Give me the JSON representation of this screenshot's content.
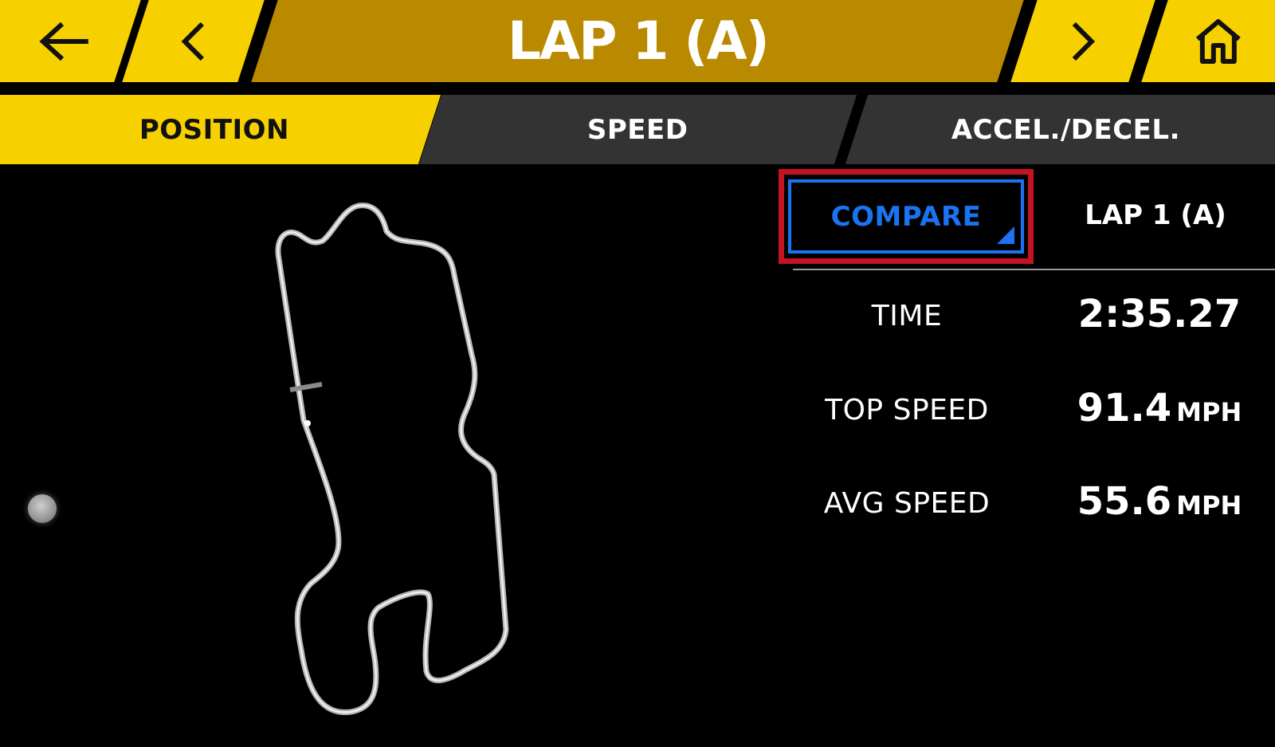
{
  "header": {
    "title": "LAP 1 (A)",
    "back_icon": "arrow-left-icon",
    "prev_icon": "chevron-left-icon",
    "next_icon": "chevron-right-icon",
    "home_icon": "home-icon"
  },
  "tabs": [
    {
      "label": "POSITION",
      "active": true
    },
    {
      "label": "SPEED",
      "active": false
    },
    {
      "label": "ACCEL./DECEL.",
      "active": false
    }
  ],
  "compare": {
    "label": "COMPARE",
    "lap_label": "LAP 1 (A)"
  },
  "stats": {
    "time": {
      "label": "TIME",
      "value": "2:35.27"
    },
    "top_speed": {
      "label": "TOP SPEED",
      "value": "91.4",
      "unit": "MPH"
    },
    "avg_speed": {
      "label": "AVG SPEED",
      "value": "55.6",
      "unit": "MPH"
    }
  },
  "colors": {
    "accent_yellow": "#f7d000",
    "title_gold": "#b98900",
    "tab_inactive": "#333333",
    "compare_blue": "#1a73f0",
    "highlight_red": "#c4141f"
  }
}
